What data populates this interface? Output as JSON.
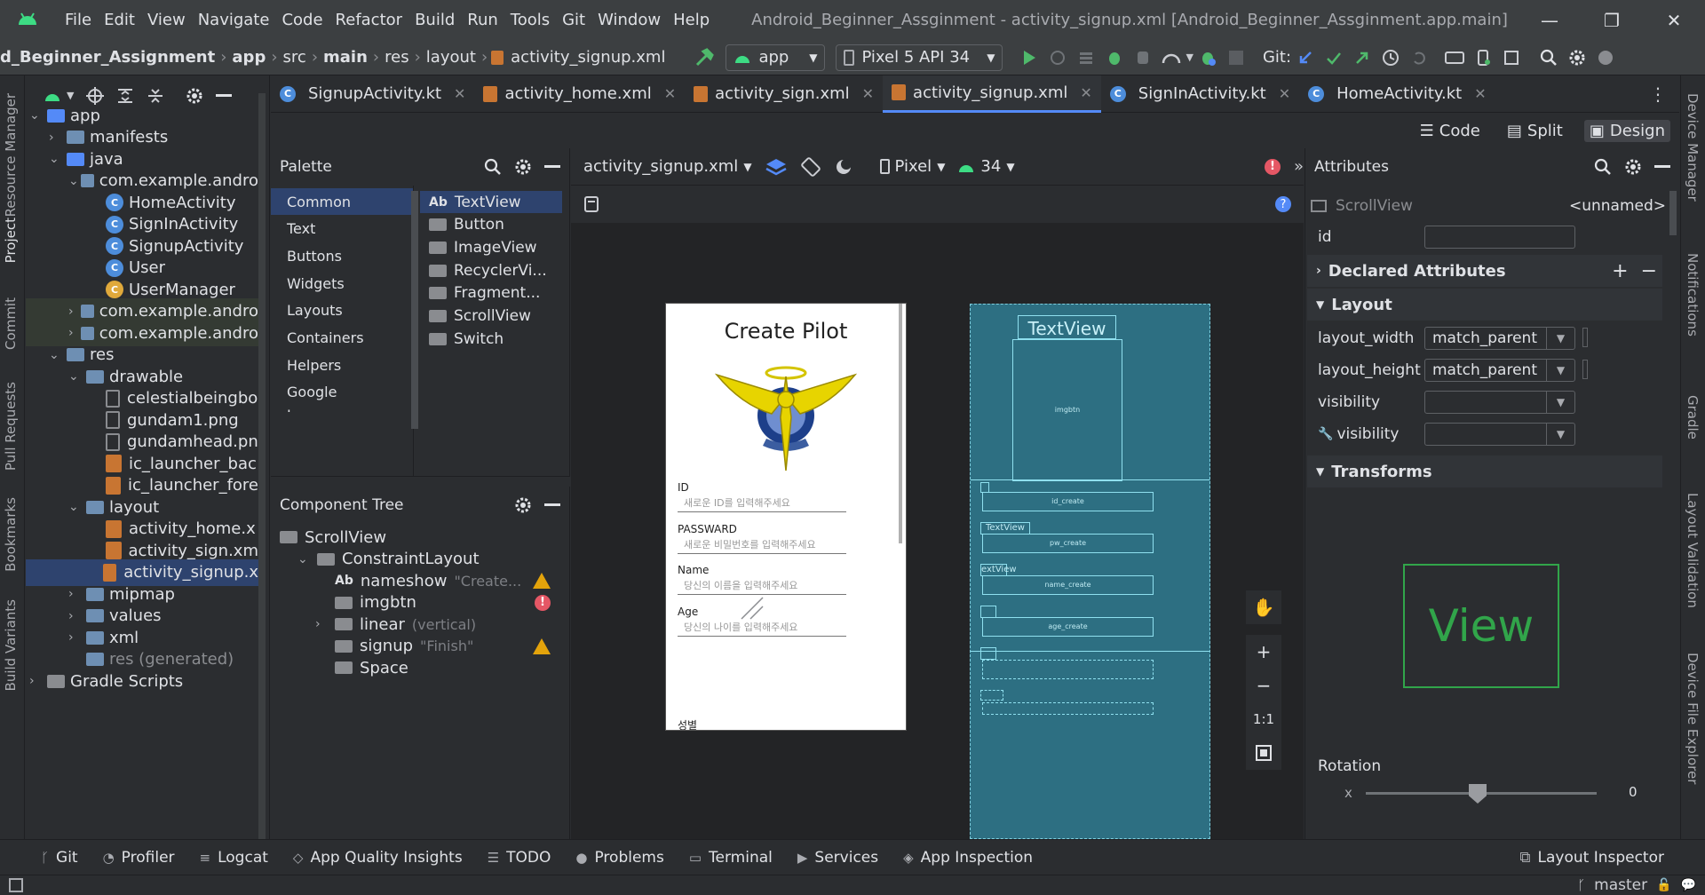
{
  "menu": [
    "File",
    "Edit",
    "View",
    "Navigate",
    "Code",
    "Refactor",
    "Build",
    "Run",
    "Tools",
    "Git",
    "Window",
    "Help"
  ],
  "window_title": "Android_Beginner_Assginment - activity_signup.xml [Android_Beginner_Assginment.app.main]",
  "breadcrumbs": [
    "d_Beginner_Assignment",
    "app",
    "src",
    "main",
    "res",
    "layout",
    "activity_signup.xml"
  ],
  "run_config": "app",
  "device": "Pixel 5 API 34",
  "git_label": "Git:",
  "tabs": [
    {
      "label": "SignupActivity.kt",
      "type": "kt"
    },
    {
      "label": "activity_home.xml",
      "type": "xml"
    },
    {
      "label": "activity_sign.xml",
      "type": "xml"
    },
    {
      "label": "activity_signup.xml",
      "type": "xml",
      "active": true
    },
    {
      "label": "SignInActivity.kt",
      "type": "kt"
    },
    {
      "label": "HomeActivity.kt",
      "type": "kt"
    }
  ],
  "view_modes": {
    "code": "Code",
    "split": "Split",
    "design": "Design"
  },
  "left_stripe": [
    "Resource Manager",
    "Project",
    "Commit",
    "Pull Requests",
    "Bookmarks",
    "Build Variants"
  ],
  "right_stripe": [
    "Device Manager",
    "Notifications",
    "Gradle",
    "Layout Validation",
    "Device File Explorer"
  ],
  "project_tree": [
    {
      "label": "app",
      "depth": 0,
      "kind": "folder-blue",
      "arrow": "v"
    },
    {
      "label": "manifests",
      "depth": 1,
      "kind": "folder",
      "arrow": ">"
    },
    {
      "label": "java",
      "depth": 1,
      "kind": "folder-blue",
      "arrow": "v"
    },
    {
      "label": "com.example.andro",
      "depth": 2,
      "kind": "folder",
      "arrow": "v"
    },
    {
      "label": "HomeActivity",
      "depth": 3,
      "kind": "kt"
    },
    {
      "label": "SignInActivity",
      "depth": 3,
      "kind": "kt"
    },
    {
      "label": "SignupActivity",
      "depth": 3,
      "kind": "kt"
    },
    {
      "label": "User",
      "depth": 3,
      "kind": "kt"
    },
    {
      "label": "UserManager",
      "depth": 3,
      "kind": "kt-y"
    },
    {
      "label": "com.example.andro",
      "depth": 2,
      "kind": "folder",
      "arrow": ">"
    },
    {
      "label": "com.example.andro",
      "depth": 2,
      "kind": "folder",
      "arrow": ">"
    },
    {
      "label": "res",
      "depth": 1,
      "kind": "folder",
      "arrow": "v"
    },
    {
      "label": "drawable",
      "depth": 2,
      "kind": "folder",
      "arrow": "v"
    },
    {
      "label": "celestialbeingbo",
      "depth": 3,
      "kind": "file"
    },
    {
      "label": "gundam1.png",
      "depth": 3,
      "kind": "file"
    },
    {
      "label": "gundamhead.pn",
      "depth": 3,
      "kind": "file"
    },
    {
      "label": "ic_launcher_bac",
      "depth": 3,
      "kind": "xml"
    },
    {
      "label": "ic_launcher_fore",
      "depth": 3,
      "kind": "xml"
    },
    {
      "label": "layout",
      "depth": 2,
      "kind": "folder",
      "arrow": "v"
    },
    {
      "label": "activity_home.x",
      "depth": 3,
      "kind": "xml"
    },
    {
      "label": "activity_sign.xm",
      "depth": 3,
      "kind": "xml"
    },
    {
      "label": "activity_signup.x",
      "depth": 3,
      "kind": "xml",
      "selected": true
    },
    {
      "label": "mipmap",
      "depth": 2,
      "kind": "folder",
      "arrow": ">"
    },
    {
      "label": "values",
      "depth": 2,
      "kind": "folder",
      "arrow": ">"
    },
    {
      "label": "xml",
      "depth": 2,
      "kind": "folder",
      "arrow": ">"
    },
    {
      "label": "res (generated)",
      "depth": 2,
      "kind": "folder"
    },
    {
      "label": "Gradle Scripts",
      "depth": 0,
      "kind": "gradle",
      "arrow": ">"
    }
  ],
  "palette": {
    "title": "Palette",
    "categories": [
      "Common",
      "Text",
      "Buttons",
      "Widgets",
      "Layouts",
      "Containers",
      "Helpers",
      "Google",
      "Legacy"
    ],
    "widgets": [
      "TextView",
      "Button",
      "ImageView",
      "RecyclerVi...",
      "Fragment...",
      "ScrollView",
      "Switch"
    ],
    "textview_prefix": "Ab"
  },
  "component_tree": {
    "title": "Component Tree",
    "items": [
      {
        "label": "ScrollView",
        "hint": "",
        "depth": 0,
        "status": ""
      },
      {
        "label": "ConstraintLayout",
        "hint": "",
        "depth": 1,
        "status": ""
      },
      {
        "label": "nameshow",
        "hint": "\"Create...",
        "depth": 2,
        "status": "warn",
        "prefix": "Ab"
      },
      {
        "label": "imgbtn",
        "hint": "",
        "depth": 2,
        "status": "err"
      },
      {
        "label": "linear",
        "hint": "(vertical)",
        "depth": 2,
        "status": ""
      },
      {
        "label": "signup",
        "hint": "\"Finish\"",
        "depth": 2,
        "status": "warn"
      },
      {
        "label": "Space",
        "hint": "",
        "depth": 2,
        "status": ""
      }
    ]
  },
  "design_toolbar": {
    "file": "activity_signup.xml",
    "device": "Pixel",
    "api": "34"
  },
  "preview": {
    "title": "Create Pilot",
    "fields": [
      {
        "label": "ID",
        "hint": "새로운 ID를 입력해주세요"
      },
      {
        "label": "PASSWARD",
        "hint": "새로운 비밀번호를 입력해주세요"
      },
      {
        "label": "Name",
        "hint": "당신의 이름을 입력해주세요"
      },
      {
        "label": "Age",
        "hint": "당신의 나이를 입력해주세요"
      }
    ],
    "next_label": "성별"
  },
  "blueprint": {
    "textview": "TextView",
    "img": "imgbtn",
    "id": "id_create",
    "textview2": "TextView",
    "pw": "pw_create",
    "tv3": "extView",
    "name": "name_create",
    "age": "age_create"
  },
  "zoom": {
    "fit": "1:1"
  },
  "attributes": {
    "title": "Attributes",
    "component": "ScrollView",
    "name": "<unnamed>",
    "id_label": "id",
    "declared": "Declared Attributes",
    "layout": "Layout",
    "layout_width_label": "layout_width",
    "layout_width": "match_parent",
    "layout_height_label": "layout_height",
    "layout_height": "match_parent",
    "visibility_label": "visibility",
    "visibility2_label": "visibility",
    "transforms": "Transforms",
    "view_preview": "View",
    "rotation": "Rotation",
    "rotation_x_label": "x",
    "rotation_x": "0"
  },
  "bottom_tools": [
    "Git",
    "Profiler",
    "Logcat",
    "App Quality Insights",
    "TODO",
    "Problems",
    "Terminal",
    "Services",
    "App Inspection"
  ],
  "layout_inspector": "Layout Inspector",
  "status": {
    "branch": "master"
  },
  "colors": {
    "accent": "#548af7",
    "warning": "#e3a30b",
    "error": "#e55765",
    "blueprint": "#2d6f82"
  }
}
